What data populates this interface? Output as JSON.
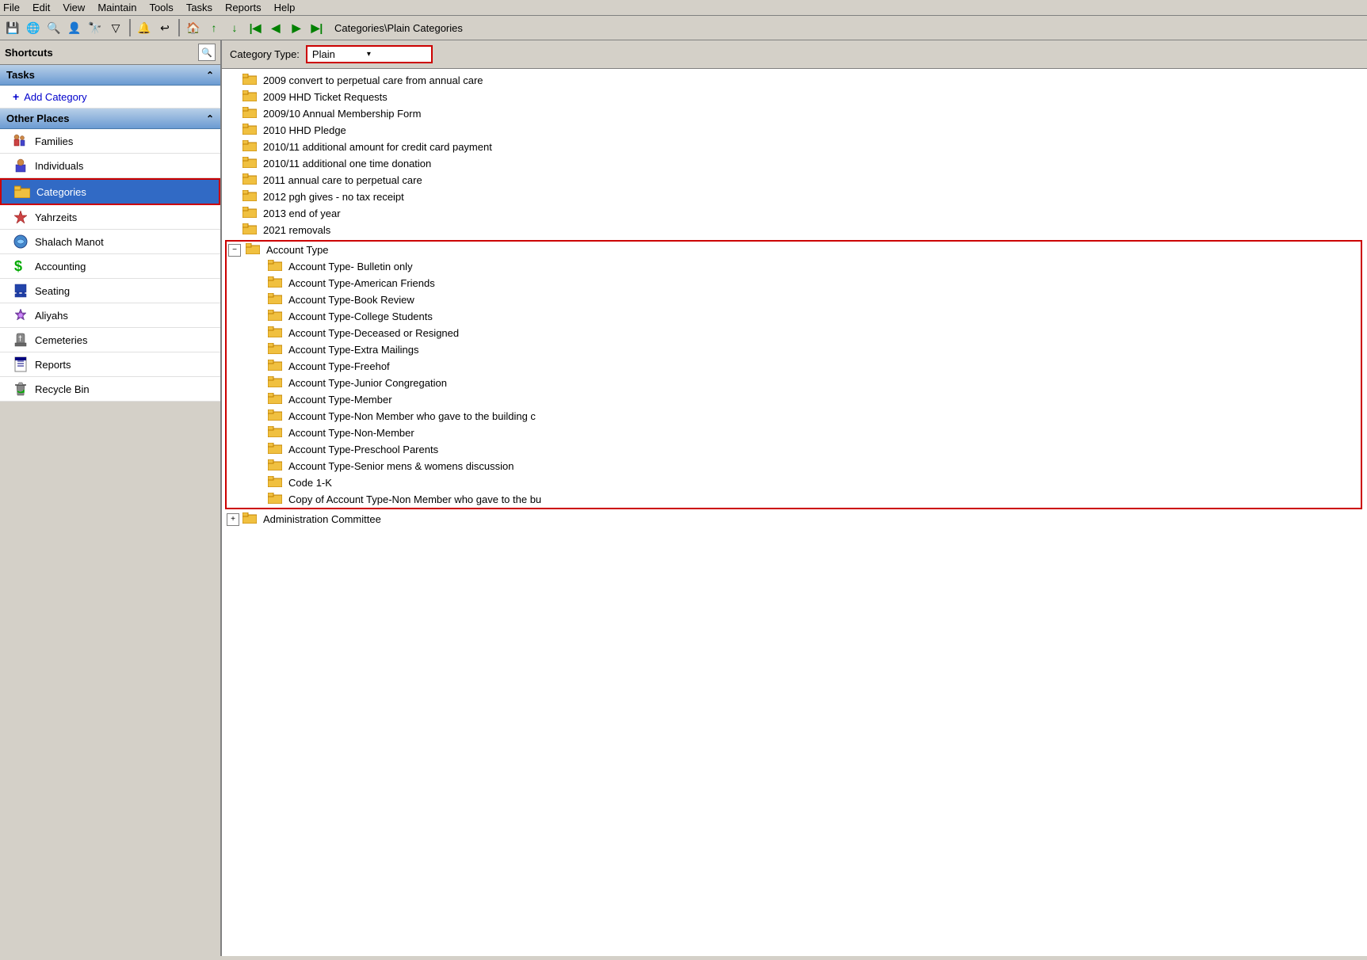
{
  "menubar": {
    "items": [
      "File",
      "Edit",
      "View",
      "Maintain",
      "Tools",
      "Tasks",
      "Reports",
      "Help"
    ]
  },
  "toolbar": {
    "breadcrumb": "Categories\\Plain Categories",
    "buttons": [
      "save",
      "globe",
      "search",
      "person",
      "binoculars",
      "filter",
      "bell",
      "undo-arrow",
      "home",
      "arrow-up-green",
      "arrow-down-green",
      "arrow-first",
      "arrow-prev",
      "arrow-next",
      "arrow-last"
    ]
  },
  "sidebar": {
    "title": "Shortcuts",
    "tasks_section": "Tasks",
    "add_category_label": "+ Add Category",
    "other_places_section": "Other Places",
    "items": [
      {
        "id": "families",
        "label": "Families",
        "icon": "families-icon"
      },
      {
        "id": "individuals",
        "label": "Individuals",
        "icon": "individuals-icon"
      },
      {
        "id": "categories",
        "label": "Categories",
        "icon": "categories-icon",
        "selected": true
      },
      {
        "id": "yahrzeits",
        "label": "Yahrzeits",
        "icon": "yahrzeits-icon"
      },
      {
        "id": "shalach-manot",
        "label": "Shalach Manot",
        "icon": "shalach-manot-icon"
      },
      {
        "id": "accounting",
        "label": "Accounting",
        "icon": "accounting-icon"
      },
      {
        "id": "seating",
        "label": "Seating",
        "icon": "seating-icon"
      },
      {
        "id": "aliyahs",
        "label": "Aliyahs",
        "icon": "aliyahs-icon"
      },
      {
        "id": "cemeteries",
        "label": "Cemeteries",
        "icon": "cemeteries-icon"
      },
      {
        "id": "reports",
        "label": "Reports",
        "icon": "reports-icon"
      },
      {
        "id": "recycle-bin",
        "label": "Recycle Bin",
        "icon": "recycle-bin-icon"
      }
    ]
  },
  "content": {
    "category_type_label": "Category Type:",
    "dropdown_value": "Plain",
    "dropdown_placeholder": "Plain",
    "tree_items_top": [
      "2009 convert to perpetual care from annual care",
      "2009 HHD Ticket Requests",
      "2009/10 Annual Membership Form",
      "2010 HHD Pledge",
      "2010/11 additional amount for credit card payment",
      "2010/11 additional one time donation",
      "2011 annual care to perpetual care",
      "2012 pgh gives - no tax receipt",
      "2013 end of year",
      "2021 removals"
    ],
    "account_type_node": "Account Type",
    "account_type_children": [
      "Account Type- Bulletin only",
      "Account Type-American Friends",
      "Account Type-Book Review",
      "Account Type-College Students",
      "Account Type-Deceased or Resigned",
      "Account Type-Extra Mailings",
      "Account Type-Freehof",
      "Account Type-Junior Congregation",
      "Account Type-Member",
      "Account Type-Non Member who gave to the building c",
      "Account Type-Non-Member",
      "Account Type-Preschool Parents",
      "Account Type-Senior mens & womens discussion",
      "Code 1-K",
      "Copy of Account Type-Non Member who gave to the bu"
    ],
    "tree_items_bottom": [
      "Administration Committee"
    ]
  }
}
